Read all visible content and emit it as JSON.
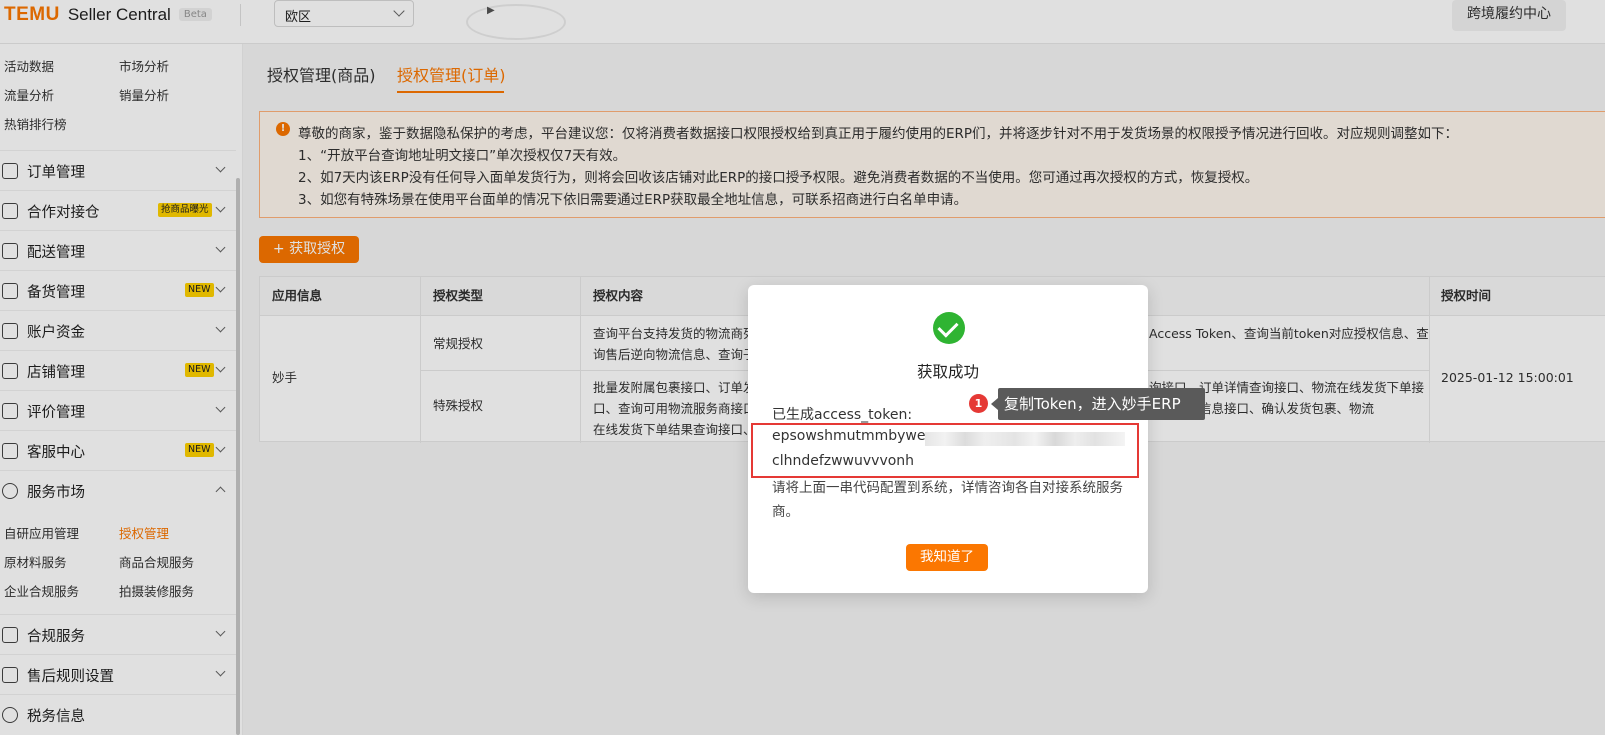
{
  "header": {
    "logo_brand": "TEMU",
    "logo_product": "Seller Central",
    "logo_badge": "Beta",
    "region_value": "欧区",
    "cross_border_button": "跨境履约中心"
  },
  "sidebar": {
    "top_grid": [
      {
        "label": "活动数据"
      },
      {
        "label": "市场分析"
      },
      {
        "label": "流量分析"
      },
      {
        "label": "销量分析"
      },
      {
        "label": "热销排行榜"
      }
    ],
    "menu": [
      {
        "label": "订单管理",
        "icon": "cart-icon",
        "badge": ""
      },
      {
        "label": "合作对接仓",
        "icon": "warehouse-icon",
        "badge": "抢商品曝光"
      },
      {
        "label": "配送管理",
        "icon": "truck-icon",
        "badge": ""
      },
      {
        "label": "备货管理",
        "icon": "stock-icon",
        "badge": "NEW"
      },
      {
        "label": "账户资金",
        "icon": "wallet-icon",
        "badge": ""
      },
      {
        "label": "店铺管理",
        "icon": "store-icon",
        "badge": "NEW"
      },
      {
        "label": "评价管理",
        "icon": "review-icon",
        "badge": ""
      },
      {
        "label": "客服中心",
        "icon": "service-icon",
        "badge": "NEW"
      },
      {
        "label": "服务市场",
        "icon": "market-icon",
        "badge": ""
      }
    ],
    "service_sub": [
      {
        "label": "自研应用管理"
      },
      {
        "label": "授权管理"
      },
      {
        "label": "原材料服务"
      },
      {
        "label": "商品合规服务"
      },
      {
        "label": "企业合规服务"
      },
      {
        "label": "拍摄装修服务"
      }
    ],
    "menu_bottom": [
      {
        "label": "合规服务",
        "icon": "compliance-icon"
      },
      {
        "label": "售后规则设置",
        "icon": "aftersale-icon"
      },
      {
        "label": "税务信息",
        "icon": "tax-icon"
      }
    ]
  },
  "tabs": [
    {
      "label": "授权管理(商品)"
    },
    {
      "label": "授权管理(订单)"
    }
  ],
  "notice": {
    "line0": "尊敬的商家，鉴于数据隐私保护的考虑，平台建议您：仅将消费者数据接口权限授权给到真正用于履约使用的ERP们，并将逐步针对不用于发货场景的权限授予情况进行回收。对应规则调整如下：",
    "line1": "1、“开放平台查询地址明文接口”单次授权仅7天有效。",
    "line2": "2、如7天内该ERP没有任何导入面单发货行为，则将会回收该店铺对此ERP的接口授予权限。避免消费者数据的不当使用。您可通过再次授权的方式，恢复授权。",
    "line3": "3、如您有特殊场景在使用平台面单的情况下依旧需要通过ERP获取最全地址信息，可联系招商进行白名单申请。"
  },
  "get_auth_button": "+ 获取授权",
  "table": {
    "headers": {
      "app": "应用信息",
      "type": "授权类型",
      "content": "授权内容",
      "time": "授权时间"
    },
    "app_name": "妙手",
    "rows": [
      {
        "type": "常规授权",
        "content_left_1": "查询平台支持发货的物流商列",
        "content_left_2": "询售后逆向物流信息、查询子",
        "content_right_1": "Access Token、查询当前token对应授权信息、查",
        "content_right_2": ""
      },
      {
        "type": "特殊授权",
        "content_left_1": "批量发附属包裹接口、订单发",
        "content_left_2": "口、查询可用物流服务商接口",
        "content_left_3": "在线发货下单结果查询接口、",
        "content_right_1": "询接口、订单详情查询接口、物流在线发货下单接",
        "content_right_2": "仓库基础信息接口、确认发货包裹、物流"
      }
    ],
    "auth_time": "2025-01-12 15:00:01"
  },
  "modal": {
    "title": "获取成功",
    "token_label": "已生成access_token:",
    "token_line1": "epsowshmutmmbywen",
    "token_line2": "clhndefzwwuvvvonh",
    "hint": "请将上面一串代码配置到系统，详情咨询各自对接系统服务商。",
    "confirm_button": "我知道了"
  },
  "annotation": {
    "step": "1",
    "text": "复制Token，进入妙手ERP"
  },
  "colors": {
    "accent": "#fb7701",
    "success": "#2fb432",
    "highlight": "#e53935"
  }
}
